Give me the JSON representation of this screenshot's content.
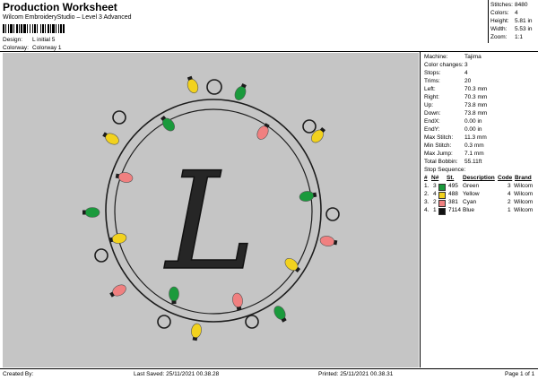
{
  "header": {
    "title": "Production Worksheet",
    "software": "Wilcom EmbroideryStudio – Level 3 Advanced",
    "design_label": "Design:",
    "design_value": "L initial 5",
    "colorway_label": "Colorway:",
    "colorway_value": "Colorway 1"
  },
  "summary": [
    {
      "label": "Stitches:",
      "value": "8480"
    },
    {
      "label": "Colors:",
      "value": "4"
    },
    {
      "label": "Height:",
      "value": "5.81 in"
    },
    {
      "label": "Width:",
      "value": "5.53 in"
    },
    {
      "label": "Zoom:",
      "value": "1:1"
    }
  ],
  "details": [
    {
      "label": "Machine:",
      "value": "Tajima"
    },
    {
      "label": "Color changes:",
      "value": "3"
    },
    {
      "label": "Stops:",
      "value": "4"
    },
    {
      "label": "Trims:",
      "value": "20"
    },
    {
      "label": "Left:",
      "value": "70.3 mm"
    },
    {
      "label": "Right:",
      "value": "70.3 mm"
    },
    {
      "label": "Up:",
      "value": "73.8 mm"
    },
    {
      "label": "Down:",
      "value": "73.8 mm"
    },
    {
      "label": "EndX:",
      "value": "0.00 in"
    },
    {
      "label": "EndY:",
      "value": "0.00 in"
    },
    {
      "label": "Max Stitch:",
      "value": "11.3 mm"
    },
    {
      "label": "Min Stitch:",
      "value": "0.3 mm"
    },
    {
      "label": "Max Jump:",
      "value": "7.1 mm"
    },
    {
      "label": "Total Bobbin:",
      "value": "55.11ft"
    }
  ],
  "stop_sequence": {
    "title": "Stop Sequence:",
    "headers": {
      "index": "#",
      "n": "N#",
      "color": "",
      "st": "St.",
      "description": "Description",
      "code": "Code",
      "brand": "Brand"
    },
    "rows": [
      {
        "index": "1.",
        "n": "3",
        "color": "#1a9a3c",
        "st": "495",
        "description": "Green",
        "code": "3",
        "brand": "Wilcom"
      },
      {
        "index": "2.",
        "n": "4",
        "color": "#f2d21e",
        "st": "488",
        "description": "Yellow",
        "code": "4",
        "brand": "Wilcom"
      },
      {
        "index": "3.",
        "n": "2",
        "color": "#f08080",
        "st": "381",
        "description": "Cyan",
        "code": "2",
        "brand": "Wilcom"
      },
      {
        "index": "4.",
        "n": "1",
        "color": "#111111",
        "st": "7114",
        "description": "Blue",
        "code": "1",
        "brand": "Wilcom"
      }
    ]
  },
  "footer": {
    "created_by": "Created By:",
    "last_saved": "Last Saved: 25/11/2021 00.38.28",
    "printed": "Printed: 25/11/2021 00.38.31",
    "page": "Page 1 of 1"
  },
  "design_art": {
    "letter": "L",
    "colors": {
      "background": "#c5c5c5",
      "wire": "#1c1c1c",
      "green": "#1a9a3c",
      "yellow": "#f2d21e",
      "pink": "#f08080"
    }
  }
}
